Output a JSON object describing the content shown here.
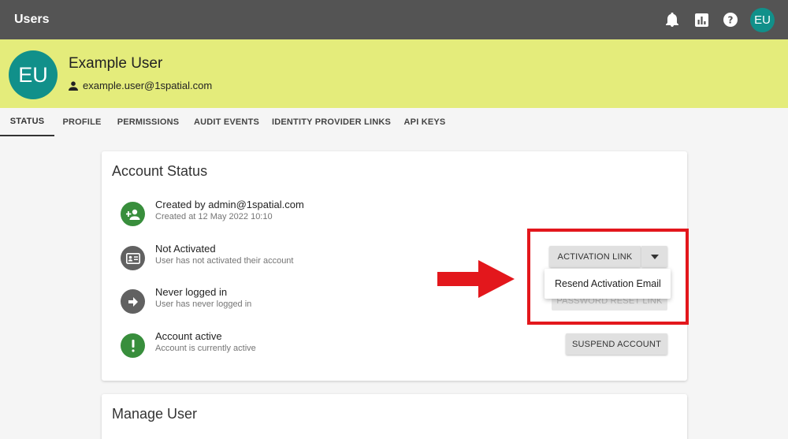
{
  "appbar": {
    "title": "Users",
    "icons": [
      "bell-icon",
      "chart-icon",
      "help-icon"
    ],
    "avatar_initials": "EU"
  },
  "user": {
    "initials": "EU",
    "name": "Example User",
    "email": "example.user@1spatial.com"
  },
  "tabs": [
    {
      "label": "STATUS",
      "active": true
    },
    {
      "label": "PROFILE",
      "active": false
    },
    {
      "label": "PERMISSIONS",
      "active": false
    },
    {
      "label": "AUDIT EVENTS",
      "active": false
    },
    {
      "label": "IDENTITY PROVIDER LINKS",
      "active": false
    },
    {
      "label": "API KEYS",
      "active": false
    }
  ],
  "account_status": {
    "title": "Account Status",
    "items": [
      {
        "title": "Created by admin@1spatial.com",
        "subtitle": "Created at 12 May 2022 10:10",
        "icon": "add-person-icon",
        "color": "#388e3c"
      },
      {
        "title": "Not Activated",
        "subtitle": "User has not activated their account",
        "icon": "id-card-icon",
        "color": "#616161"
      },
      {
        "title": "Never logged in",
        "subtitle": "User has never logged in",
        "icon": "arrow-right-icon",
        "color": "#616161"
      },
      {
        "title": "Account active",
        "subtitle": "Account is currently active",
        "icon": "exclamation-icon",
        "color": "#388e3c"
      }
    ],
    "buttons": {
      "activation_link": "ACTIVATION LINK",
      "password_reset_link": "PASSWORD RESET LINK",
      "suspend_account": "SUSPEND ACCOUNT"
    },
    "menu": {
      "item": "Resend Activation Email"
    }
  },
  "manage_user": {
    "title": "Manage User"
  },
  "colors": {
    "appbar": "#545454",
    "header": "#e4ec7b",
    "avatar": "#11908a",
    "highlight": "#e3171c"
  }
}
